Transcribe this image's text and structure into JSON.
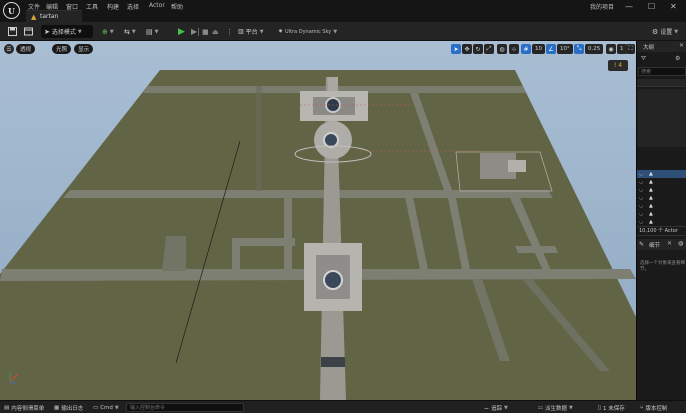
{
  "app": {
    "logo": "U",
    "menu": [
      "文件",
      "编辑",
      "窗口",
      "工具",
      "构建",
      "选择",
      "Actor",
      "帮助"
    ],
    "document_tab": "tartan",
    "project_name": "我的项目",
    "window_buttons": [
      "—",
      "☐",
      "✕"
    ]
  },
  "toolbar": {
    "mode_label": "选择模式",
    "platform_label": "平台",
    "settings_label": "设置",
    "extra_label": "Ultra Dynamic Sky"
  },
  "viewport": {
    "perspective_label": "透视",
    "lit_label": "光照",
    "show_label": "显示",
    "grid_snap": "10",
    "rotation_snap": "10°",
    "scale_snap": "0.25",
    "camera_speed": "1",
    "warning_text": "! 4"
  },
  "outliner": {
    "title": "大纲",
    "filter_placeholder": "搜索",
    "rows_visible": 8,
    "count_text": "10,100 个 Actor",
    "details_title": "细节",
    "details_hint": "选择一个对象来查看细节。"
  },
  "statusbar": {
    "content_drawer": "内容侧滑菜单",
    "output_log": "输出日志",
    "cmd_label": "Cmd",
    "cmd_placeholder": "输入控制台命令",
    "trace_label": "追踪",
    "derived_data": "派生数据",
    "unsaved": "1 未保存",
    "source_control": "版本控制"
  },
  "colors": {
    "accent_blue": "#2a6fc7",
    "play_green": "#3ec447",
    "warning_yellow": "#e6b422",
    "ground": "#626446"
  }
}
